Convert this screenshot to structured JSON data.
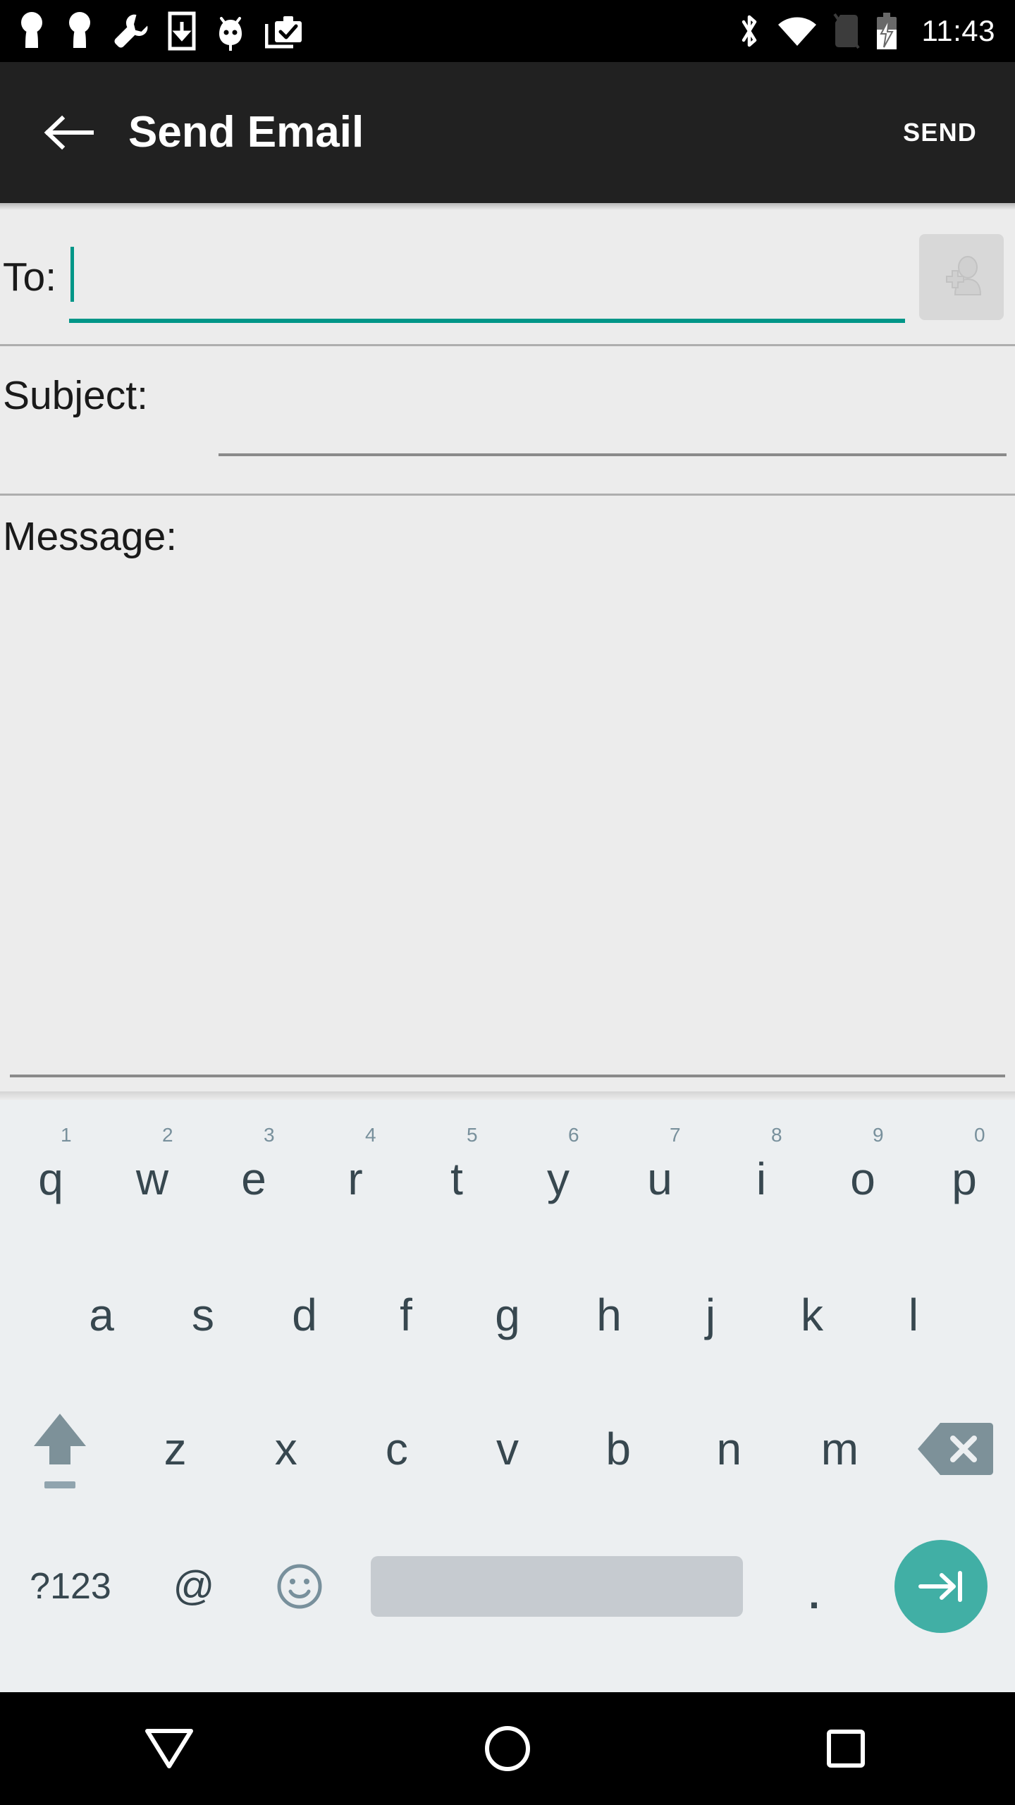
{
  "statusbar": {
    "left_icons": [
      {
        "name": "person-pin-icon"
      },
      {
        "name": "person-pin-icon"
      },
      {
        "name": "wrench-icon"
      },
      {
        "name": "phone-download-icon"
      },
      {
        "name": "android-bug-icon"
      },
      {
        "name": "briefcase-check-icon"
      }
    ],
    "right_icons": [
      {
        "name": "bluetooth-icon"
      },
      {
        "name": "wifi-icon"
      },
      {
        "name": "no-sim-icon"
      },
      {
        "name": "battery-charging-icon"
      }
    ],
    "clock": "11:43"
  },
  "appbar": {
    "back_icon": "arrow-back-icon",
    "title": "Send Email",
    "action_label": "SEND"
  },
  "form": {
    "to": {
      "label": "To:",
      "value": "",
      "placeholder": "",
      "focused": true,
      "underline_color": "#009688",
      "contact_button_icon": "add-contact-icon"
    },
    "subject": {
      "label": "Subject:",
      "value": "",
      "placeholder": "",
      "focused": false,
      "underline_color": "#8A8A8A"
    },
    "message": {
      "label": "Message:",
      "value": "",
      "placeholder": "",
      "focused": false,
      "underline_color": "#8A8A8A"
    }
  },
  "keyboard": {
    "row1": [
      {
        "key": "q",
        "hint": "1"
      },
      {
        "key": "w",
        "hint": "2"
      },
      {
        "key": "e",
        "hint": "3"
      },
      {
        "key": "r",
        "hint": "4"
      },
      {
        "key": "t",
        "hint": "5"
      },
      {
        "key": "y",
        "hint": "6"
      },
      {
        "key": "u",
        "hint": "7"
      },
      {
        "key": "i",
        "hint": "8"
      },
      {
        "key": "o",
        "hint": "9"
      },
      {
        "key": "p",
        "hint": "0"
      }
    ],
    "row2": [
      {
        "key": "a"
      },
      {
        "key": "s"
      },
      {
        "key": "d"
      },
      {
        "key": "f"
      },
      {
        "key": "g"
      },
      {
        "key": "h"
      },
      {
        "key": "j"
      },
      {
        "key": "k"
      },
      {
        "key": "l"
      }
    ],
    "row3": {
      "shift_icon": "shift-icon",
      "letters": [
        {
          "key": "z"
        },
        {
          "key": "x"
        },
        {
          "key": "c"
        },
        {
          "key": "v"
        },
        {
          "key": "b"
        },
        {
          "key": "n"
        },
        {
          "key": "m"
        }
      ],
      "backspace_icon": "backspace-icon"
    },
    "row4": {
      "symbols_label": "?123",
      "at_label": "@",
      "emoji_icon": "emoji-smiley-icon",
      "space_label": "",
      "period_label": ".",
      "enter_icon": "tab-next-icon",
      "enter_color": "#41AFA5"
    }
  },
  "navbar": {
    "back_icon": "nav-back-triangle-icon",
    "home_icon": "nav-home-circle-icon",
    "recents_icon": "nav-recents-square-icon"
  }
}
